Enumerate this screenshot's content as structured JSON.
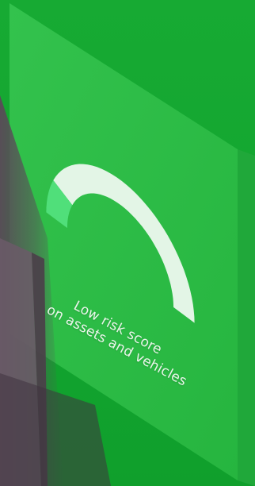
{
  "colors": {
    "background": "#16a932",
    "card": "#2fbd48",
    "gauge_filled": "#50df7a",
    "gauge_remaining": "#e3f5e6",
    "device": "#5a4a58"
  },
  "risk_gauge": {
    "level_fraction": 0.14,
    "label_line1": "Low risk score",
    "label_line2": "on assets and vehicles"
  }
}
